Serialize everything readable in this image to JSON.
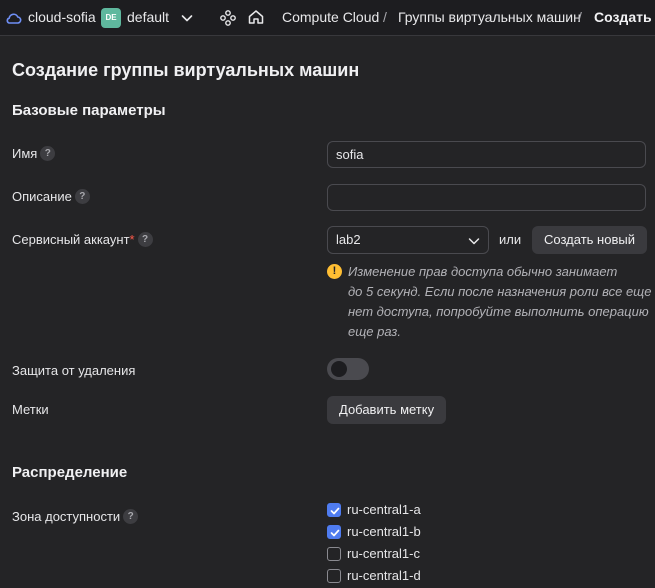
{
  "header": {
    "cloud_name": "cloud-sofia",
    "folder_badge": "DE",
    "folder_name": "default",
    "breadcrumbs": [
      "Compute Cloud",
      "Группы виртуальных машин",
      "Создать"
    ],
    "separator": "/"
  },
  "page": {
    "title": "Создание группы виртуальных машин"
  },
  "basic": {
    "section_title": "Базовые параметры",
    "name_label": "Имя",
    "name_value": "sofia",
    "description_label": "Описание",
    "description_value": "",
    "service_account_label": "Сервисный аккаунт",
    "required_mark": "*",
    "service_account_value": "lab2",
    "or_text": "или",
    "create_new_label": "Создать новый",
    "warning_lines": [
      "Изменение прав доступа обычно занимает",
      "до 5 секунд. Если после назначения роли все еще",
      "нет доступа, попробуйте выполнить операцию",
      "еще раз."
    ],
    "warning_icon": "!",
    "deletion_protection_label": "Защита от удаления",
    "deletion_protection_enabled": false,
    "labels_label": "Метки",
    "add_label_button": "Добавить метку",
    "help_glyph": "?"
  },
  "distribution": {
    "section_title": "Распределение",
    "zone_label": "Зона доступности",
    "zones": [
      {
        "name": "ru-central1-a",
        "checked": true
      },
      {
        "name": "ru-central1-b",
        "checked": true
      },
      {
        "name": "ru-central1-c",
        "checked": false
      },
      {
        "name": "ru-central1-d",
        "checked": false
      }
    ]
  },
  "colors": {
    "background": "#242426",
    "accent": "#4f7cf0",
    "warning": "#ffbe33",
    "folder_badge": "#5fb89e"
  }
}
